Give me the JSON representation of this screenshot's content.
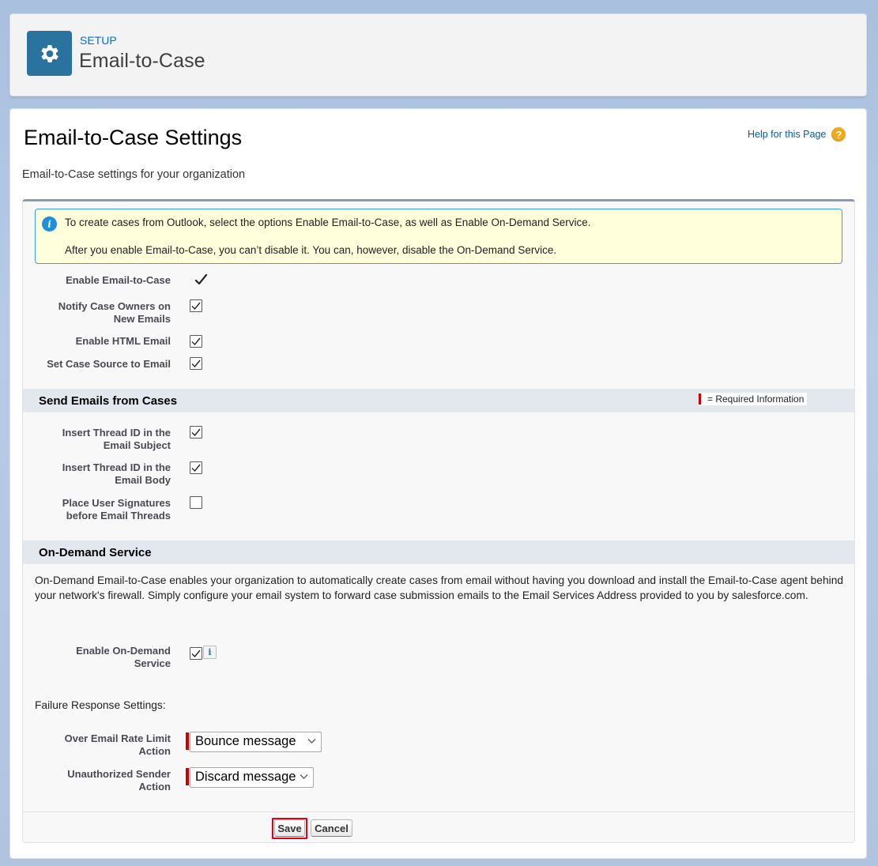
{
  "header": {
    "setup_label": "SETUP",
    "title": "Email-to-Case",
    "icon": "gear-icon"
  },
  "page": {
    "title": "Email-to-Case Settings",
    "help_link": "Help for this Page",
    "description": "Email-to-Case settings for your organization"
  },
  "info_box": {
    "line1": "To create cases from Outlook, select the options Enable Email-to-Case, as well as Enable On-Demand Service.",
    "line2": "After you enable Email-to-Case, you can’t disable it. You can, however, disable the On-Demand Service."
  },
  "general_settings": [
    {
      "label": "Enable Email-to-Case",
      "checked": true,
      "locked": true
    },
    {
      "label_line1": "Notify Case Owners on",
      "label_line2": "New Emails",
      "checked": true
    },
    {
      "label": "Enable HTML Email",
      "checked": true
    },
    {
      "label": "Set Case Source to Email",
      "checked": true
    }
  ],
  "send_emails_section": {
    "title": "Send Emails from Cases",
    "required_legend": "= Required Information",
    "fields": [
      {
        "label_line1": "Insert Thread ID in the",
        "label_line2": "Email Subject",
        "checked": true
      },
      {
        "label_line1": "Insert Thread ID in the",
        "label_line2": "Email Body",
        "checked": true
      },
      {
        "label_line1": "Place User Signatures",
        "label_line2": "before Email Threads",
        "checked": false
      }
    ]
  },
  "on_demand_section": {
    "title": "On-Demand Service",
    "description": "On-Demand Email-to-Case enables your organization to automatically create cases from email without having you download and install the Email-to-Case agent behind your network's firewall. Simply configure your email system to forward case submission emails to the Email Services Address provided to you by salesforce.com.",
    "enable_label_line1": "Enable On-Demand",
    "enable_label_line2": "Service",
    "enable_checked": true,
    "info_glyph": "i",
    "failure_heading": "Failure Response Settings:",
    "over_rate_label_line1": "Over Email Rate Limit",
    "over_rate_label_line2": "Action",
    "over_rate_value": "Bounce message",
    "unauth_label_line1": "Unauthorized Sender",
    "unauth_label_line2": "Action",
    "unauth_value": "Discard message"
  },
  "buttons": {
    "save": "Save",
    "cancel": "Cancel"
  },
  "colors": {
    "accent": "#0070d2",
    "header_icon_bg": "#2a739e",
    "required": "#cc0000",
    "info_box_bg": "#ffffdc",
    "save_highlight": "#e0001a"
  }
}
